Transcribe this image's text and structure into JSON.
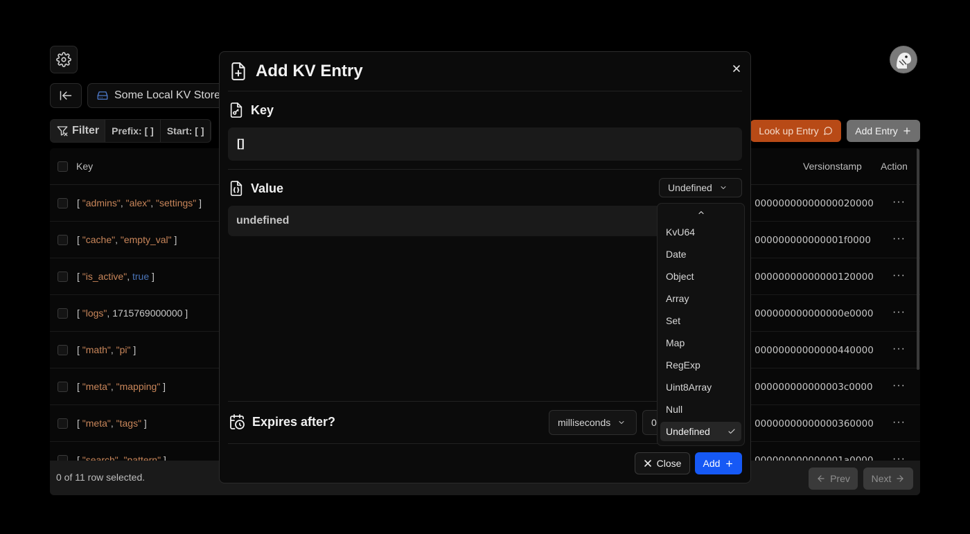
{
  "app": {
    "store_name": "Some Local KV Store",
    "filter": {
      "label": "Filter",
      "prefix": "Prefix: [ ]",
      "start": "Start: [ ]"
    },
    "lookup_label": "Look up Entry",
    "add_entry_label": "Add Entry",
    "table": {
      "col_key": "Key",
      "col_versionstamp": "Versionstamp",
      "col_action": "Action",
      "rows": [
        {
          "open": "[ ",
          "parts": [
            {
              "t": "\"admins\"",
              "c": "str"
            },
            {
              "t": ", ",
              "c": ""
            },
            {
              "t": "\"alex\"",
              "c": "str"
            },
            {
              "t": ", ",
              "c": ""
            },
            {
              "t": "\"settings\"",
              "c": "str"
            }
          ],
          "close": " ]",
          "versionstamp": "00000000000000020000"
        },
        {
          "open": "[ ",
          "parts": [
            {
              "t": "\"cache\"",
              "c": "str"
            },
            {
              "t": ", ",
              "c": ""
            },
            {
              "t": "\"empty_val\"",
              "c": "str"
            }
          ],
          "close": " ]",
          "versionstamp": "000000000000001f0000"
        },
        {
          "open": "[ ",
          "parts": [
            {
              "t": "\"is_active\"",
              "c": "str"
            },
            {
              "t": ", ",
              "c": ""
            },
            {
              "t": "true",
              "c": "kw"
            }
          ],
          "close": " ]",
          "versionstamp": "00000000000000120000"
        },
        {
          "open": "[ ",
          "parts": [
            {
              "t": "\"logs\"",
              "c": "str"
            },
            {
              "t": ", ",
              "c": ""
            },
            {
              "t": "1715769000000",
              "c": ""
            }
          ],
          "close": " ]",
          "versionstamp": "000000000000000e0000"
        },
        {
          "open": "[ ",
          "parts": [
            {
              "t": "\"math\"",
              "c": "str"
            },
            {
              "t": ", ",
              "c": ""
            },
            {
              "t": "\"pi\"",
              "c": "str"
            }
          ],
          "close": " ]",
          "versionstamp": "00000000000000440000"
        },
        {
          "open": "[ ",
          "parts": [
            {
              "t": "\"meta\"",
              "c": "str"
            },
            {
              "t": ", ",
              "c": ""
            },
            {
              "t": "\"mapping\"",
              "c": "str"
            }
          ],
          "close": " ]",
          "versionstamp": "000000000000003c0000"
        },
        {
          "open": "[ ",
          "parts": [
            {
              "t": "\"meta\"",
              "c": "str"
            },
            {
              "t": ", ",
              "c": ""
            },
            {
              "t": "\"tags\"",
              "c": "str"
            }
          ],
          "close": " ]",
          "versionstamp": "00000000000000360000"
        },
        {
          "open": "[ ",
          "parts": [
            {
              "t": "\"search\"",
              "c": "str"
            },
            {
              "t": ", ",
              "c": ""
            },
            {
              "t": "\"pattern\"",
              "c": "str"
            }
          ],
          "close": " ]",
          "versionstamp": "000000000000001a0000"
        }
      ]
    },
    "footer": {
      "selected": "0 of 11 row selected.",
      "prev": "Prev",
      "next": "Next"
    }
  },
  "modal": {
    "title": "Add KV Entry",
    "key_label": "Key",
    "key_value": "[]",
    "value_label": "Value",
    "value_type": "Undefined",
    "value_content": "undefined",
    "expires_label": "Expires after?",
    "expires_unit": "milliseconds",
    "expires_value": "0",
    "close_label": "Close",
    "add_label": "Add"
  },
  "dropdown": {
    "options": [
      "KvU64",
      "Date",
      "Object",
      "Array",
      "Set",
      "Map",
      "RegExp",
      "Uint8Array",
      "Null",
      "Undefined"
    ],
    "selected": "Undefined"
  },
  "colors": {
    "accent_blue": "#1659f5",
    "lookup_orange": "#b84a16",
    "string_literal": "#c9865a",
    "keyword": "#4a74b8"
  }
}
